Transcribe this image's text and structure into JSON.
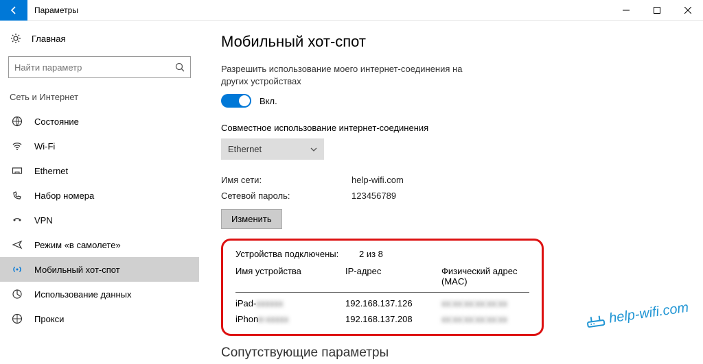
{
  "window": {
    "title": "Параметры"
  },
  "sidebar": {
    "home": "Главная",
    "search_placeholder": "Найти параметр",
    "section": "Сеть и Интернет",
    "items": [
      {
        "label": "Состояние"
      },
      {
        "label": "Wi-Fi"
      },
      {
        "label": "Ethernet"
      },
      {
        "label": "Набор номера"
      },
      {
        "label": "VPN"
      },
      {
        "label": "Режим «в самолете»"
      },
      {
        "label": "Мобильный хот-спот"
      },
      {
        "label": "Использование данных"
      },
      {
        "label": "Прокси"
      }
    ]
  },
  "content": {
    "title": "Мобильный хот-спот",
    "desc": "Разрешить использование моего интернет-соединения на других устройствах",
    "toggle_label": "Вкл.",
    "share_label": "Совместное использование интернет-соединения",
    "share_value": "Ethernet",
    "net_name_label": "Имя сети:",
    "net_name_value": "help-wifi.com",
    "net_pass_label": "Сетевой пароль:",
    "net_pass_value": "123456789",
    "edit_btn": "Изменить",
    "devices_label": "Устройства подключены:",
    "devices_count": "2 из 8",
    "th_name": "Имя устройства",
    "th_ip": "IP-адрес",
    "th_mac": "Физический адрес (MAC)",
    "rows": [
      {
        "name_visible": "iPad-",
        "name_blur": "xxxxxx",
        "ip": "192.168.137.126",
        "mac": "xx:xx:xx:xx:xx:xx"
      },
      {
        "name_visible": "iPhon",
        "name_blur": "e-xxxxx",
        "ip": "192.168.137.208",
        "mac": "xx:xx:xx:xx:xx:xx"
      }
    ],
    "related_heading": "Сопутствующие параметры"
  },
  "watermark": "help-wifi.com"
}
